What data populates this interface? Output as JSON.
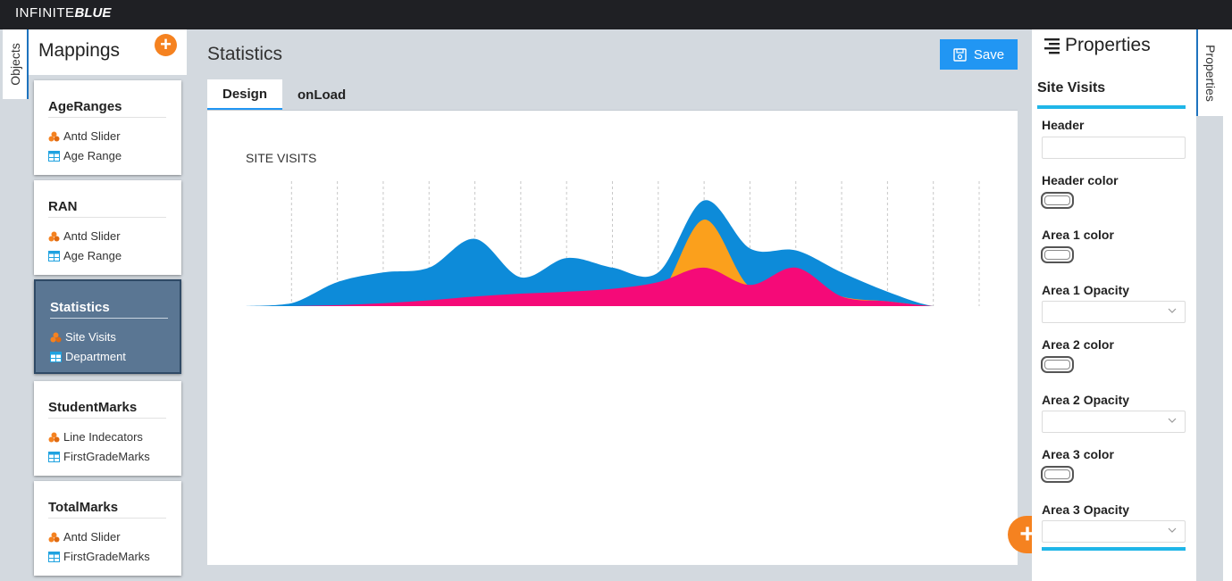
{
  "brand": {
    "part1": "INFINITE",
    "part2": "BLUE"
  },
  "left_tab": {
    "label": "Objects"
  },
  "mappings": {
    "title": "Mappings",
    "add_label": "+",
    "cards": [
      {
        "title": "AgeRanges",
        "line1": "Antd Slider",
        "line2": "Age Range"
      },
      {
        "title": "RAN",
        "line1": "Antd Slider",
        "line2": "Age Range"
      },
      {
        "title": "Statistics",
        "line1": "Site Visits",
        "line2": "Department"
      },
      {
        "title": "StudentMarks",
        "line1": "Line Indecators",
        "line2": "FirstGradeMarks"
      },
      {
        "title": "TotalMarks",
        "line1": "Antd Slider",
        "line2": "FirstGradeMarks"
      }
    ]
  },
  "main": {
    "title": "Statistics",
    "save_label": "Save",
    "tabs": [
      {
        "label": "Design"
      },
      {
        "label": "onLoad"
      }
    ],
    "fab_label": "+"
  },
  "properties": {
    "title": "Properties",
    "section": "Site Visits",
    "fields": {
      "header": "Header",
      "header_color": "Header color",
      "area1_color": "Area 1 color",
      "area1_opacity": "Area 1 Opacity",
      "area2_color": "Area 2 color",
      "area2_opacity": "Area 2 Opacity",
      "area3_color": "Area 3 color",
      "area3_opacity": "Area 3 Opacity"
    },
    "vtab_label": "Properties"
  },
  "colors": {
    "accent": "#2196f3",
    "orange": "#f58220",
    "area_blue": "#0d8bd9",
    "area_orange": "#fba01c",
    "area_pink": "#f50a78"
  },
  "chart_data": {
    "type": "area",
    "title": "SITE VISITS",
    "x": [
      0,
      1,
      2,
      3,
      4,
      5,
      6,
      7,
      8,
      9,
      10,
      11,
      12,
      13,
      14,
      15,
      16
    ],
    "ylim": [
      0,
      130
    ],
    "grid": true,
    "series": [
      {
        "values": [
          0,
          0,
          1,
          3,
          6,
          10,
          13,
          15,
          18,
          25,
          40,
          22,
          40,
          10,
          5,
          0,
          0
        ]
      },
      {
        "values": [
          0,
          0,
          0,
          1,
          4,
          2,
          12,
          5,
          10,
          10,
          90,
          20,
          30,
          10,
          5,
          0,
          0
        ]
      },
      {
        "values": [
          0,
          3,
          25,
          35,
          40,
          70,
          30,
          50,
          40,
          35,
          110,
          60,
          58,
          35,
          15,
          0,
          0
        ]
      }
    ]
  }
}
